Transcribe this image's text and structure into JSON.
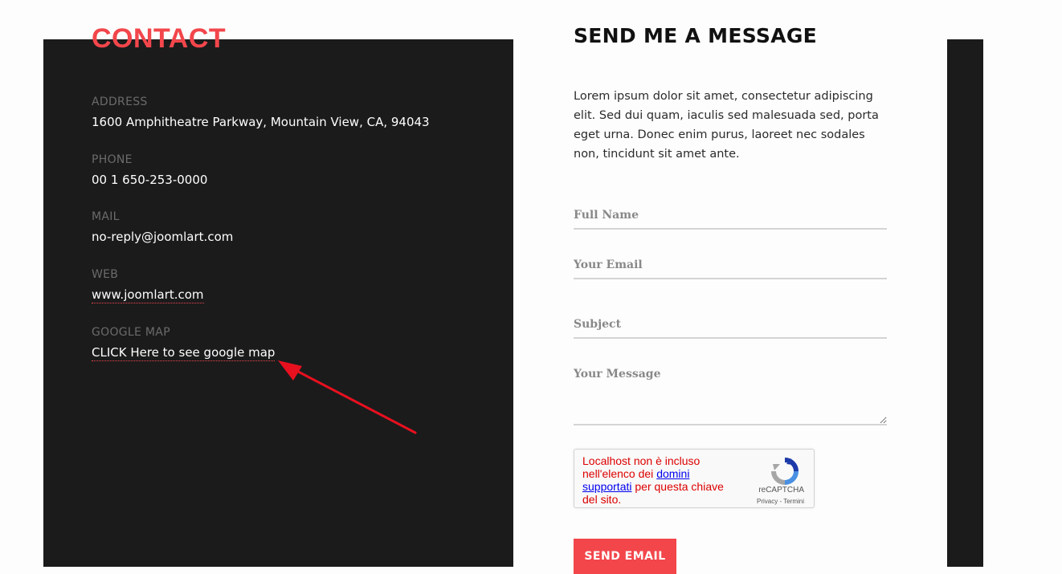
{
  "contact": {
    "title": "CONTACT",
    "address_label": "ADDRESS",
    "address_value": "1600 Amphitheatre Parkway, Mountain View, CA, 94043",
    "phone_label": "PHONE",
    "phone_value": "00 1 650-253-0000",
    "mail_label": "MAIL",
    "mail_value": "no-reply@joomlart.com",
    "web_label": "WEB",
    "web_value": "www.joomlart.com",
    "map_label": "GOOGLE MAP",
    "map_value": "CLICK Here to see google map"
  },
  "form": {
    "title": "SEND ME A MESSAGE",
    "intro": "Lorem ipsum dolor sit amet, consectetur adipiscing elit. Sed dui quam, iaculis sed malesuada sed, porta eget urna. Donec enim purus, laoreet nec sodales non, tincidunt sit amet ante.",
    "full_name_placeholder": "Full Name",
    "email_placeholder": "Your Email",
    "subject_placeholder": "Subject",
    "message_placeholder": "Your Message",
    "submit_label": "SEND EMAIL"
  },
  "recaptcha": {
    "error_part1": "Localhost non è incluso nell'elenco dei ",
    "error_link": "domini supportati",
    "error_part2": " per questa chiave del sito.",
    "brand": "reCAPTCHA",
    "terms": "Privacy - Termini"
  },
  "colors": {
    "accent": "#f2464b",
    "dark_panel": "#1b1b1c",
    "annotation_arrow": "#e8101e"
  }
}
